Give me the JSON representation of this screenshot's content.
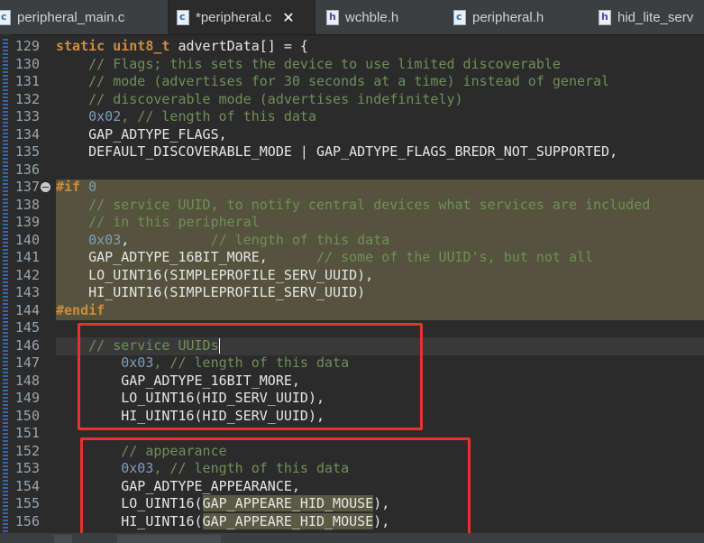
{
  "tabs": [
    {
      "label": "peripheral_main.c",
      "type": "c",
      "active": false
    },
    {
      "label": "*peripheral.c",
      "type": "c",
      "active": true
    },
    {
      "label": "wchble.h",
      "type": "h",
      "active": false
    },
    {
      "label": "peripheral.h",
      "type": "h",
      "active": false
    },
    {
      "label": "hid_lite_serv",
      "type": "h",
      "active": false
    }
  ],
  "icons": {
    "c": "c-file-icon",
    "h": "h-file-icon",
    "close": "close-tab-icon"
  },
  "line_numbers": [
    "129",
    "130",
    "131",
    "132",
    "133",
    "134",
    "135",
    "136",
    "137",
    "138",
    "139",
    "140",
    "141",
    "142",
    "143",
    "144",
    "145",
    "146",
    "147",
    "148",
    "149",
    "150",
    "151",
    "152",
    "153",
    "154",
    "155",
    "156"
  ],
  "code": {
    "l129_kw1": "static",
    "l129_kw2": " uint8_t",
    "l129_rest": " advertData[] = {",
    "l130": "    // Flags; this sets the device to use limited discoverable",
    "l131": "    // mode (advertises for 30 seconds at a time) instead of general",
    "l132": "    // discoverable mode (advertises indefinitely)",
    "l133_num": "    0x02",
    "l133_cm": ", // length of this data",
    "l133_cm2": " // length of this data",
    "l134": "    GAP_ADTYPE_FLAGS,",
    "l135": "    DEFAULT_DISCOVERABLE_MODE | GAP_ADTYPE_FLAGS_BREDR_NOT_SUPPORTED,",
    "l137_pp": "#if",
    "l137_num": " 0",
    "l138": "    // service UUID, to notify central devices what services are included",
    "l139": "    // in this peripheral",
    "l140_num": "    0x03",
    "l140_sep": ",",
    "l140_cm": "          // length of this data",
    "l141_code": "    GAP_ADTYPE_16BIT_MORE,",
    "l141_cm": "      // some of the UUID's, but not all",
    "l142": "    LO_UINT16(SIMPLEPROFILE_SERV_UUID),",
    "l143": "    HI_UINT16(SIMPLEPROFILE_SERV_UUID)",
    "l144_pp": "#endif",
    "l146": "    // service UUIDs",
    "l147_num": "        0x03",
    "l147_cm": ", // length of this data",
    "l148": "        GAP_ADTYPE_16BIT_MORE,",
    "l149": "        LO_UINT16(HID_SERV_UUID),",
    "l150": "        HI_UINT16(HID_SERV_UUID),",
    "l152": "        // appearance",
    "l153_num": "        0x03",
    "l153_cm": ", // length of this data",
    "l154": "        GAP_ADTYPE_APPEARANCE,",
    "l155_a": "        LO_UINT16(",
    "l155_b": "GAP_APPEARE_HID_MOUSE",
    "l155_c": "),",
    "l156_a": "        HI_UINT16(",
    "l156_b": "GAP_APPEARE_HID_MOUSE",
    "l156_c": "),"
  },
  "colors": {
    "keyword": "#ce8b3c",
    "comment": "#6f8f57",
    "number": "#7a9fc0",
    "disabled_block": "#55533e",
    "annotation_box": "#e8322e"
  }
}
